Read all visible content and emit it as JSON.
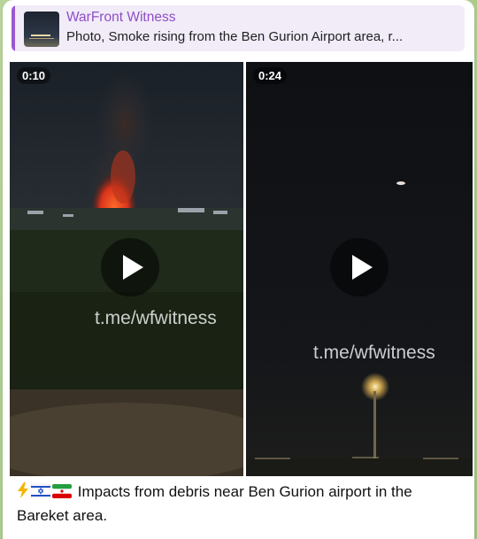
{
  "reply": {
    "title": "WarFront Witness",
    "text": "Photo, Smoke rising from the Ben Gurion Airport area, r..."
  },
  "videos": [
    {
      "duration": "0:10",
      "watermark": "t.me/wfwitness"
    },
    {
      "duration": "0:24",
      "watermark": "t.me/wfwitness"
    }
  ],
  "caption": {
    "emoji_icons": [
      "lightning-emoji",
      "israel-flag-emoji",
      "iran-flag-emoji"
    ],
    "text": "Impacts from debris near Ben Gurion airport in the Bareket area."
  },
  "colors": {
    "sender_name": "#8e4ec6",
    "reply_bar": "#9b59d0",
    "reply_bg": "#f1ecf8",
    "chat_background": "#a9c98a"
  }
}
